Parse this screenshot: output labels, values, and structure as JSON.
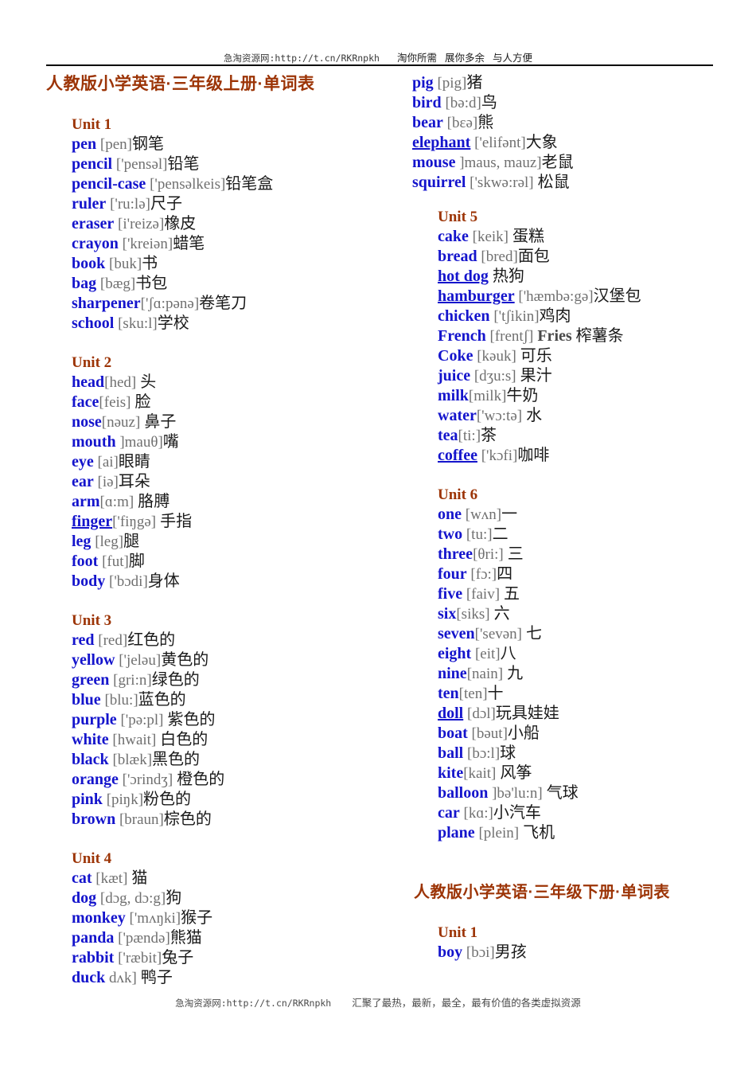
{
  "header": {
    "site": "急淘资源网:http://t.cn/RKRnpkh",
    "slogan1": "淘你所需",
    "slogan2": "展你多余",
    "slogan3": "与人方便"
  },
  "footer": {
    "site": "急淘资源网:http://t.cn/RKRnpkh",
    "slogan": "汇聚了最热，最新，最全，最有价值的各类虚拟资源"
  },
  "titles": {
    "book1": "人教版小学英语·三年级上册·单词表",
    "book2": "人教版小学英语·三年级下册·单词表"
  },
  "colors": {
    "heading": "#9c3406",
    "word": "#1414cc",
    "phonetic": "#707070",
    "chinese": "#1a1a1a"
  },
  "left_column": [
    {
      "unit": "Unit 1",
      "words": [
        {
          "en": "pen",
          "ph": " [pen]",
          "cn": "钢笔"
        },
        {
          "en": "pencil",
          "ph": " ['pensəl]",
          "cn": "铅笔"
        },
        {
          "en": "pencil-case",
          "ph": " ['pensəlkeis]",
          "cn": "铅笔盒"
        },
        {
          "en": "ruler",
          "ph": " ['ru:lə]",
          "cn": "尺子"
        },
        {
          "en": "eraser",
          "ph": " [i'reizə]",
          "cn": "橡皮"
        },
        {
          "en": "crayon",
          "ph": " ['kreiən]",
          "cn": "蜡笔"
        },
        {
          "en": "book",
          "ph": " [buk]",
          "cn": "书"
        },
        {
          "en": "bag",
          "ph": " [bæg]",
          "cn": "书包"
        },
        {
          "en": "sharpener",
          "ph": "['ʃɑ:pənə]",
          "cn": "卷笔刀"
        },
        {
          "en": "school",
          "ph": " [sku:l]",
          "cn": "学校"
        }
      ]
    },
    {
      "unit": "Unit 2",
      "words": [
        {
          "en": "head",
          "ph": "[hed]",
          "cn": " 头"
        },
        {
          "en": "face",
          "ph": "[feis]",
          "cn": " 脸"
        },
        {
          "en": "nose",
          "ph": "[nəuz]",
          "cn": " 鼻子"
        },
        {
          "en": "mouth",
          "ph": " ]mauθ]",
          "cn": "嘴"
        },
        {
          "en": "eye",
          "ph": " [ai]",
          "cn": "眼睛"
        },
        {
          "en": "ear",
          "ph": " [iə]",
          "cn": "耳朵"
        },
        {
          "en": "arm",
          "ph": "[ɑ:m]",
          "cn": "  胳膊"
        },
        {
          "en": "finger",
          "ph": "['fiŋgə]",
          "cn": " 手指",
          "link": true
        },
        {
          "en": "leg",
          "ph": " [leg]",
          "cn": "腿"
        },
        {
          "en": "foot",
          "ph": " [fut]",
          "cn": "脚"
        },
        {
          "en": "body",
          "ph": " ['bɔdi]",
          "cn": "身体"
        }
      ]
    },
    {
      "unit": "Unit 3",
      "words": [
        {
          "en": "red",
          "ph": " [red]",
          "cn": "红色的"
        },
        {
          "en": "yellow",
          "ph": " ['jeləu]",
          "cn": "黄色的"
        },
        {
          "en": "green",
          "ph": " [gri:n]",
          "cn": "绿色的"
        },
        {
          "en": "blue",
          "ph": " [blu:]",
          "cn": "蓝色的"
        },
        {
          "en": "purple",
          "ph": " ['pə:pl]",
          "cn": " 紫色的"
        },
        {
          "en": "white",
          "ph": " [hwait]",
          "cn": " 白色的"
        },
        {
          "en": "black",
          "ph": " [blæk]",
          "cn": "黑色的"
        },
        {
          "en": "orange",
          "ph": " ['ɔrindʒ]",
          "cn": " 橙色的"
        },
        {
          "en": "pink",
          "ph": " [piŋk]",
          "cn": "粉色的"
        },
        {
          "en": "brown",
          "ph": " [braun]",
          "cn": "棕色的"
        }
      ]
    },
    {
      "unit": "Unit 4",
      "words": [
        {
          "en": "cat",
          "ph": " [kæt]",
          "cn": " 猫"
        },
        {
          "en": "dog",
          "ph": " [dɔg, dɔ:g]",
          "cn": "狗"
        },
        {
          "en": "monkey",
          "ph": " ['mʌŋki]",
          "cn": "猴子"
        },
        {
          "en": "panda",
          "ph": " ['pændə]",
          "cn": "熊猫"
        },
        {
          "en": "rabbit",
          "ph": " ['ræbit]",
          "cn": "兔子"
        },
        {
          "en": "duck",
          "ph": " dʌk]",
          "cn": " 鸭子"
        }
      ]
    }
  ],
  "right_column_continued": [
    {
      "en": "pig",
      "ph": " [pig]",
      "cn": "猪"
    },
    {
      "en": "bird",
      "ph": " [bə:d]",
      "cn": "鸟"
    },
    {
      "en": "bear",
      "ph": " [bɛə]",
      "cn": "熊"
    },
    {
      "en": "elephant",
      "ph": " ['elifənt]",
      "cn": "大象",
      "link": true
    },
    {
      "en": "mouse",
      "ph": " ]maus, mauz]",
      "cn": "老鼠"
    },
    {
      "en": "squirrel",
      "ph": " ['skwə:rəl]",
      "cn": " 松鼠"
    }
  ],
  "right_column": [
    {
      "unit": "Unit 5",
      "words": [
        {
          "en": "cake",
          "ph": " [keik]",
          "cn": " 蛋糕"
        },
        {
          "en": "bread",
          "ph": " [bred]",
          "cn": "面包"
        },
        {
          "en": "hot dog",
          "ph": "",
          "cn": " 热狗",
          "link": true
        },
        {
          "en": "hamburger",
          "ph": " ['hæmbə:gə]",
          "cn": "汉堡包",
          "link": true
        },
        {
          "en": "chicken",
          "ph": " ['tʃikin]",
          "cn": "鸡肉"
        },
        {
          "en": "French",
          "ph": " [frentʃ]",
          "cn": " 榨薯条",
          "bold_extra": " Fries"
        },
        {
          "en": "Coke",
          "ph": " [kəuk]",
          "cn": " 可乐"
        },
        {
          "en": "juice",
          "ph": " [dʒu:s]",
          "cn": " 果汁"
        },
        {
          "en": "milk",
          "ph": "[milk]",
          "cn": "牛奶"
        },
        {
          "en": "water",
          "ph": "['wɔ:tə]",
          "cn": " 水"
        },
        {
          "en": "tea",
          "ph": "[ti:]",
          "cn": "茶"
        },
        {
          "en": "coffee",
          "ph": " ['kɔfi]",
          "cn": "咖啡",
          "link": true
        }
      ]
    },
    {
      "unit": "Unit 6",
      "words": [
        {
          "en": "one",
          "ph": " [wʌn]",
          "cn": "一"
        },
        {
          "en": "two",
          "ph": " [tu:]",
          "cn": "二"
        },
        {
          "en": "three",
          "ph": "[θri:]",
          "cn": " 三"
        },
        {
          "en": "four",
          "ph": " [fɔ:]",
          "cn": "四"
        },
        {
          "en": "five",
          "ph": " [faiv]",
          "cn": "  五"
        },
        {
          "en": "six",
          "ph": "[siks]",
          "cn": " 六"
        },
        {
          "en": "seven",
          "ph": "['sevən]",
          "cn": " 七"
        },
        {
          "en": "eight",
          "ph": " [eit]",
          "cn": "八"
        },
        {
          "en": "nine",
          "ph": "[nain]",
          "cn": " 九"
        },
        {
          "en": "ten",
          "ph": "[ten]",
          "cn": "十"
        },
        {
          "en": "doll",
          "ph": " [dɔl]",
          "cn": "玩具娃娃",
          "link": true
        },
        {
          "en": "boat",
          "ph": " [bəut]",
          "cn": "小船"
        },
        {
          "en": "ball",
          "ph": " [bɔ:l]",
          "cn": "球"
        },
        {
          "en": "kite",
          "ph": "[kait]",
          "cn": "  风筝"
        },
        {
          "en": "balloon",
          "ph": " ]bə'lu:n]",
          "cn": " 气球"
        },
        {
          "en": "car",
          "ph": " [kɑ:]",
          "cn": "小汽车"
        },
        {
          "en": "plane",
          "ph": " [plein]",
          "cn": " 飞机"
        }
      ]
    }
  ],
  "book2_section": {
    "unit": "Unit 1",
    "words": [
      {
        "en": "boy",
        "ph": " [bɔi]",
        "cn": "男孩"
      }
    ]
  }
}
